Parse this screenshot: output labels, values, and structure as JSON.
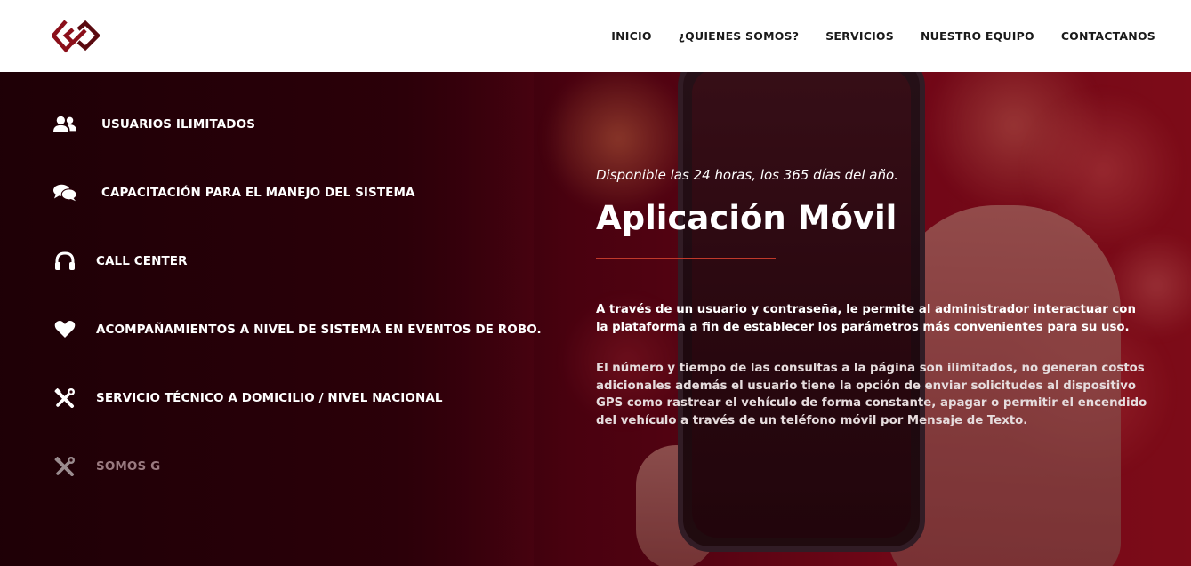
{
  "header": {
    "logo_icon": "diamond-chain-logo",
    "nav": [
      {
        "label": "INICIO"
      },
      {
        "label": "¿QUIENES SOMOS?"
      },
      {
        "label": "SERVICIOS"
      },
      {
        "label": "NUESTRO EQUIPO"
      },
      {
        "label": "CONTACTANOS"
      }
    ]
  },
  "features": [
    {
      "icon": "users-icon",
      "label": "USUARIOS ILIMITADOS"
    },
    {
      "icon": "chat-bubbles-icon",
      "label": "CAPACITACIÓN PARA EL MANEJO DEL SISTEMA"
    },
    {
      "icon": "headphones-icon",
      "label": "CALL CENTER"
    },
    {
      "icon": "heart-icon",
      "label": "ACOMPAÑAMIENTOS A NIVEL DE SISTEMA EN EVENTOS DE ROBO."
    },
    {
      "icon": "tools-icon",
      "label": "SERVICIO TÉCNICO A DOMICILIO / NIVEL NACIONAL"
    },
    {
      "icon": "tools-icon",
      "label": "SOMOS G"
    }
  ],
  "content": {
    "tagline": "Disponible las 24 horas, los 365 días del año.",
    "title": "Aplicación Móvil",
    "paragraph1": "A través de un usuario y contraseña, le permite al administrador interactuar con la plataforma a fin de establecer los parámetros más convenientes para su uso.",
    "paragraph2": "El número y tiempo de las consultas a la página son ilimitados, no generan costos adicionales además el usuario tiene la opción de enviar solicitudes al dispositivo GPS como rastrear el vehículo de forma constante, apagar o permitir el encendido del vehículo a través de un teléfono móvil por Mensaje de Texto."
  },
  "colors": {
    "brand_red": "#8b0f1a",
    "divider_red": "#c0392b",
    "header_bg": "#ffffff"
  }
}
